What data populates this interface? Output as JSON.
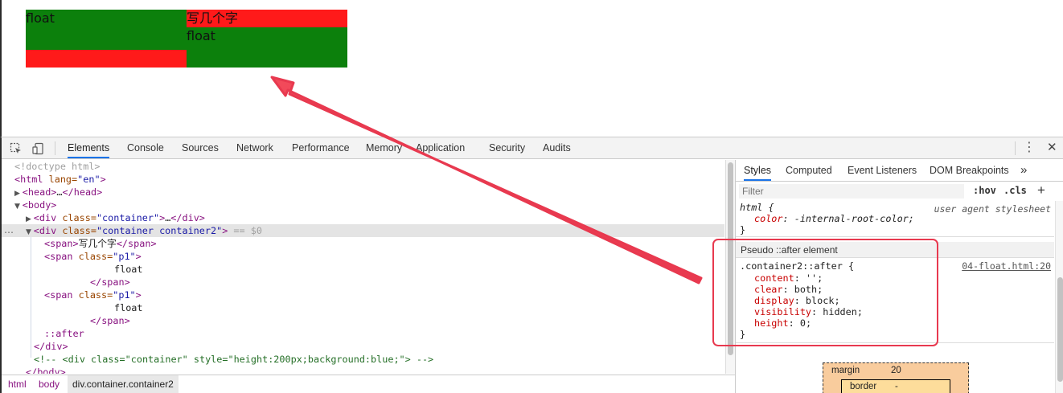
{
  "preview": {
    "blocks": [
      {
        "text": "float"
      },
      {
        "text": "写几个字"
      },
      {
        "text": "float"
      },
      {
        "text": ""
      }
    ],
    "colors": {
      "green": "#0c800c",
      "red": "#ff1a1a"
    }
  },
  "toolbar": {
    "tabs": [
      "Elements",
      "Console",
      "Sources",
      "Network",
      "Performance",
      "Memory",
      "Application",
      "Security",
      "Audits"
    ],
    "active_tab": "Elements",
    "icons": {
      "inspect": "inspect-cursor-icon",
      "device": "device-toggle-icon",
      "more": "vertical-dots-icon",
      "close": "close-icon"
    },
    "more_glyph": "⋮",
    "close_glyph": "✕"
  },
  "elements": {
    "doctype": "<!doctype html>",
    "html_open": {
      "tag": "<html",
      "attr": " lang=",
      "val": "\"en\"",
      "end": ">"
    },
    "head": {
      "tag": "<head>",
      "dots": "…",
      "close": "</head>"
    },
    "body_open": "<body>",
    "div1": {
      "tag": "<div",
      "attr": " class=",
      "val": "\"container\"",
      "end": ">",
      "dots": "…",
      "close": "</div>"
    },
    "div2": {
      "tag": "<div",
      "attr": " class=",
      "val": "\"container container2\"",
      "end": ">",
      "eq": " == $0"
    },
    "span1": {
      "open": "<span>",
      "text": "写几个字",
      "close": "</span>"
    },
    "span2": {
      "tag": "<span",
      "attr": " class=",
      "val": "\"p1\"",
      "end": ">",
      "text": "float",
      "close": "</span>"
    },
    "span3": {
      "tag": "<span",
      "attr": " class=",
      "val": "\"p1\"",
      "end": ">",
      "text": "float",
      "close": "</span>"
    },
    "after": "::after",
    "div_close": "</div>",
    "comment": "<!-- <div class=\"container\" style=\"height:200px;background:blue;\"> -->",
    "body_close": "</body>",
    "dots": "…"
  },
  "breadcrumbs": [
    "html",
    "body",
    "div.container.container2"
  ],
  "styles": {
    "tabs": [
      "Styles",
      "Computed",
      "Event Listeners",
      "DOM Breakpoints"
    ],
    "tabs_more": "»",
    "filter_placeholder": "Filter",
    "hov": ":hov",
    "cls": ".cls",
    "plus": "+",
    "rule1": {
      "selector": "html {",
      "source": "user agent stylesheet",
      "prop": "color",
      "value": " -internal-root-color;",
      "close": "}"
    },
    "pseudo_header": "Pseudo ::after element",
    "rule2": {
      "selector": ".container2::after {",
      "source": "04-float.html:20",
      "props": [
        {
          "name": "content",
          "value": " '';"
        },
        {
          "name": "clear",
          "value": " both;"
        },
        {
          "name": "display",
          "value": " block;"
        },
        {
          "name": "visibility",
          "value": " hidden;"
        },
        {
          "name": "height",
          "value": " 0;"
        }
      ],
      "close": "}"
    },
    "boxmodel": {
      "margin_label": "margin",
      "margin_value": "20",
      "border_label": "border",
      "border_value": "-"
    }
  },
  "annotation": {
    "color": "#e8394f"
  }
}
